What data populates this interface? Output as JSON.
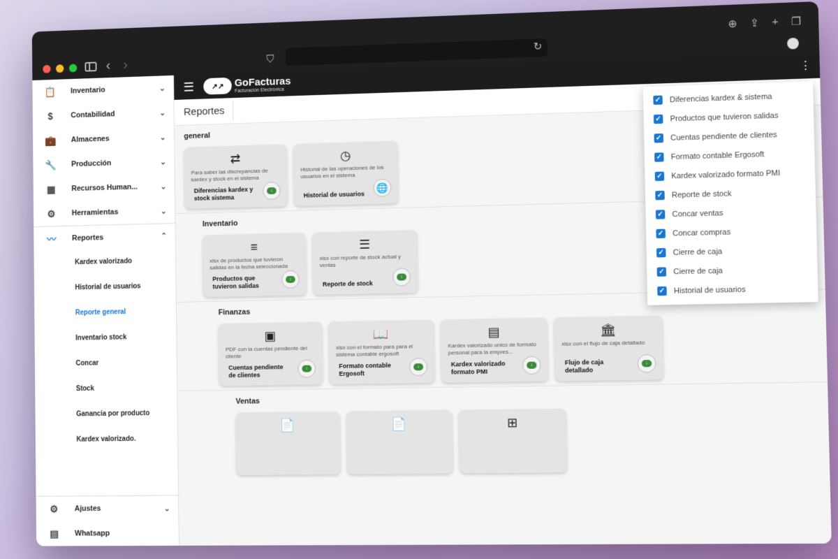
{
  "browser": {
    "icons": {
      "sidebar": "sidebar-toggle-icon",
      "back": "chevron-left-icon",
      "forward": "chevron-right-icon",
      "shield": "shield-icon",
      "reload": "reload-icon",
      "download": "download-icon",
      "share": "share-icon",
      "new_tab": "plus-icon",
      "tabs": "tabs-icon",
      "profile": "profile-icon"
    }
  },
  "appbar": {
    "brand": "GoFacturas",
    "brand_sub": "Facturación Electrónica"
  },
  "page": {
    "title": "Reportes"
  },
  "sidebar": {
    "items": [
      {
        "label": "Inventario",
        "icon": "clipboard-icon"
      },
      {
        "label": "Contabilidad",
        "icon": "dollar-icon"
      },
      {
        "label": "Almacenes",
        "icon": "briefcase-icon"
      },
      {
        "label": "Producción",
        "icon": "wrench-icon"
      },
      {
        "label": "Recursos Human...",
        "icon": "building-icon"
      },
      {
        "label": "Herramientas",
        "icon": "tools-icon"
      },
      {
        "label": "Reportes",
        "icon": "trend-icon"
      }
    ],
    "sub_items": [
      "Kardex valorizado",
      "Historial de usuarios",
      "Reporte general",
      "Inventario stock",
      "Concar",
      "Stock",
      "Ganancia por producto",
      "Kardex valorizado."
    ],
    "bottom": [
      {
        "label": "Ajustes",
        "icon": "gear-icon"
      },
      {
        "label": "Whatsapp",
        "icon": "chat-icon"
      }
    ]
  },
  "sections": {
    "general": {
      "title": "general",
      "cards": [
        {
          "desc": "Para saber las discrepancias de kardex y stock en el sistema",
          "title": "Diferencias kardex y stock sistema"
        },
        {
          "desc": "Historial de las operaciones de los usuarios en el sistema",
          "title": "Historial de usuarios"
        }
      ]
    },
    "inventario": {
      "title": "Inventario",
      "cards": [
        {
          "desc": "xlsx de productos que tuvieron salidas en la fecha seleccionada",
          "title": "Productos que tuvieron salidas"
        },
        {
          "desc": "xlsx con reporte de stock actual y ventas",
          "title": "Reporte de stock"
        }
      ]
    },
    "finanzas": {
      "title": "Finanzas",
      "cards": [
        {
          "desc": "PDF con la cuentas pendiente del cliente",
          "title": "Cuentas pendiente de clientes"
        },
        {
          "desc": "xlsx con el formato para para el sistema contable ergosoft",
          "title": "Formato contable Ergosoft"
        },
        {
          "desc": "Kardex valorizado unico de formato personal para la empres...",
          "title": "Kardex valorizado formato PMI"
        },
        {
          "desc": "xlsx con el flujo de caja detallado",
          "title": "Flujo de caja detallado"
        }
      ]
    },
    "ventas": {
      "title": "Ventas"
    }
  },
  "dropdown": {
    "items": [
      "Diferencias kardex & sistema",
      "Productos que tuvieron salidas",
      "Cuentas pendiente de clientes",
      "Formato contable Ergosoft",
      "Kardex valorizado formato PMI",
      "Reporte de stock",
      "Concar ventas",
      "Concar compras",
      "Cierre de caja",
      "Cierre de caja",
      "Historial de usuarios"
    ]
  }
}
